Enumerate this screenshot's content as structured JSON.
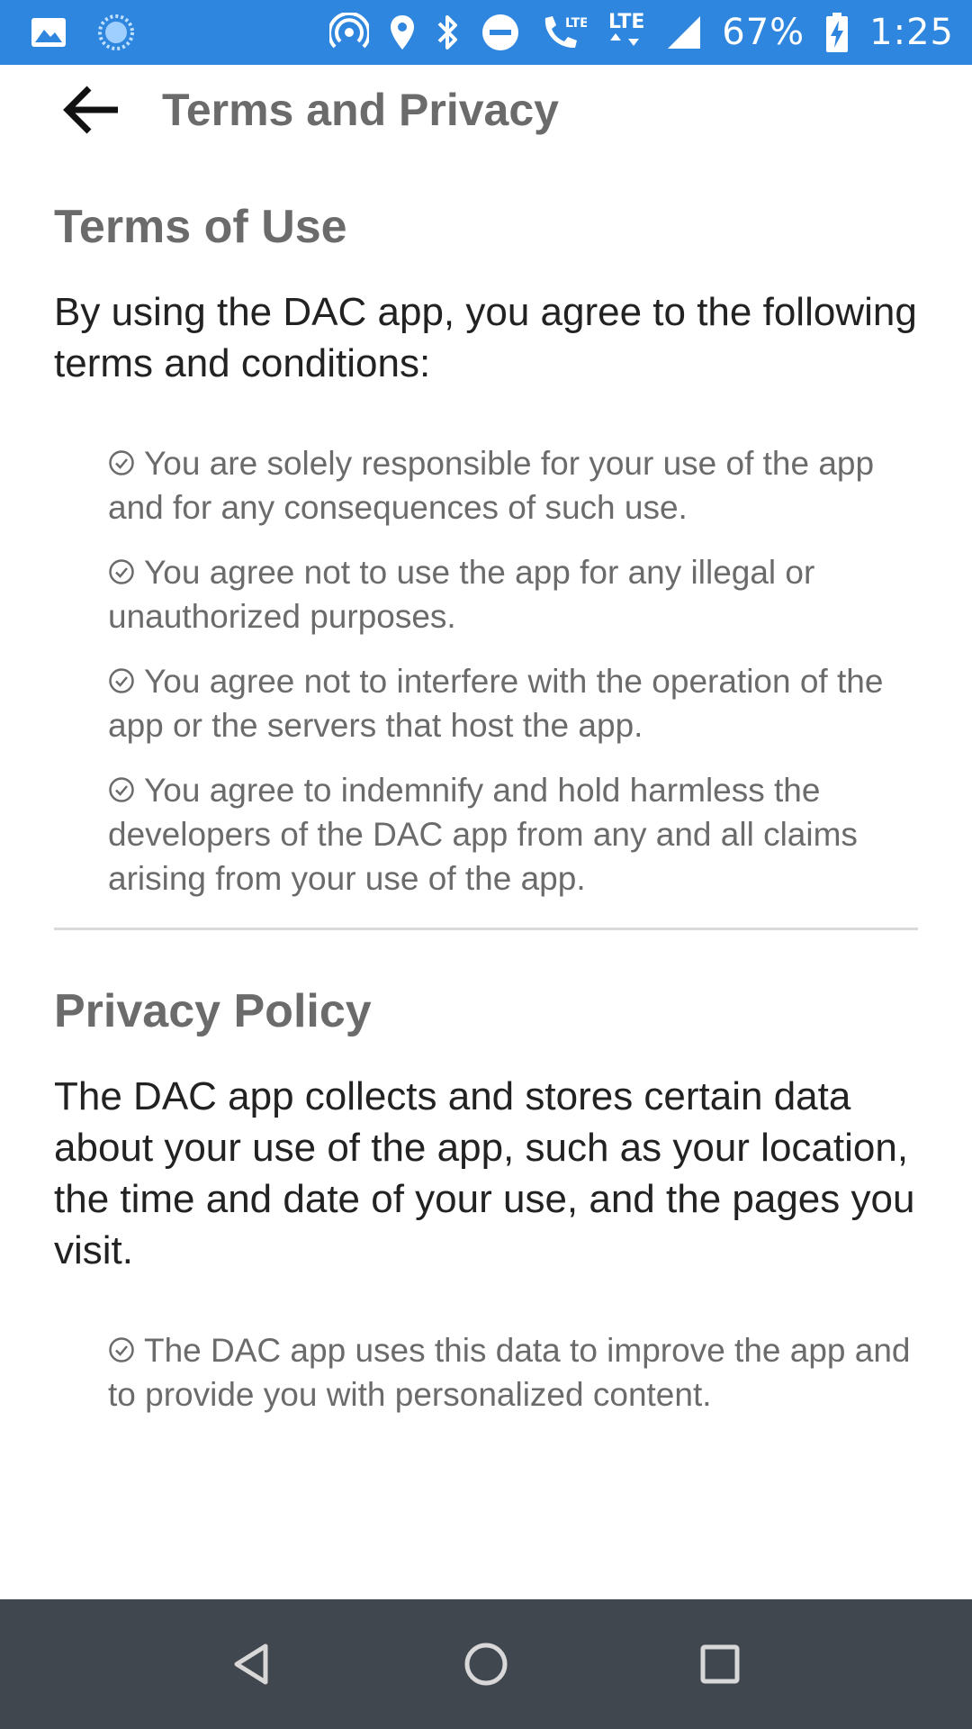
{
  "status_bar": {
    "battery_percent": "67%",
    "time": "1:25",
    "network_1": "LTE",
    "network_2": "LTE",
    "icons": [
      "gallery-icon",
      "sync-icon",
      "hotspot-icon",
      "location-icon",
      "bluetooth-icon",
      "do-not-disturb-icon",
      "wifi-calling-icon",
      "lte-icon",
      "signal-icon",
      "battery-charging-icon"
    ]
  },
  "header": {
    "title": "Terms and Privacy",
    "back_icon": "back-arrow-icon"
  },
  "terms": {
    "title": "Terms of Use",
    "intro": "By using the DAC app, you agree to the following terms and conditions:",
    "items": [
      "You are solely responsible for your use of the app and for any consequences of such use.",
      "You agree not to use the app for any illegal or unauthorized purposes.",
      "You agree not to interfere with the operation of the app or the servers that host the app.",
      "You agree to indemnify and hold harmless the developers of the DAC app from any and all claims arising from your use of the app."
    ]
  },
  "privacy": {
    "title": "Privacy Policy",
    "intro": "The DAC app collects and stores certain data about your use of the app, such as your location, the time and date of your use, and the pages you visit.",
    "items": [
      "The DAC app uses this data to improve the app and to provide you with personalized content."
    ]
  },
  "nav_bar": {
    "buttons": [
      "back-nav-icon",
      "home-nav-icon",
      "recents-nav-icon"
    ]
  },
  "colors": {
    "status_bar": "#2f86de",
    "nav_bar": "#41474e",
    "heading_gray": "#6b6b6b",
    "body_text": "#222222",
    "divider": "#d9d9d9"
  }
}
